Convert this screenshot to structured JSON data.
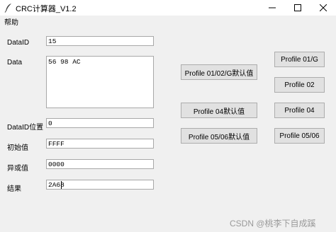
{
  "window": {
    "title": "CRC计算器_V1.2",
    "controls": [
      "minimize",
      "maximize",
      "close"
    ]
  },
  "menu": {
    "help": "帮助"
  },
  "form": {
    "dataid": {
      "label": "DataID",
      "value": "15"
    },
    "data": {
      "label": "Data",
      "value": "56 98 AC"
    },
    "dataid_position": {
      "label": "DataID位置",
      "value": "0"
    },
    "initial_value": {
      "label": "初始值",
      "value": "FFFF"
    },
    "xor_value": {
      "label": "异或值",
      "value": "0000"
    },
    "result": {
      "label": "结果",
      "value": "2A68"
    }
  },
  "buttons": {
    "profile_01_02_g_default": "Profile 01/02/G默认值",
    "profile_04_default": "Profile 04默认值",
    "profile_05_06_default": "Profile 05/06默认值",
    "profile_01_g": "Profile 01/G",
    "profile_02": "Profile 02",
    "profile_04": "Profile 04",
    "profile_05_06": "Profile 05/06"
  },
  "watermark": "CSDN @桃李下自成蹊"
}
